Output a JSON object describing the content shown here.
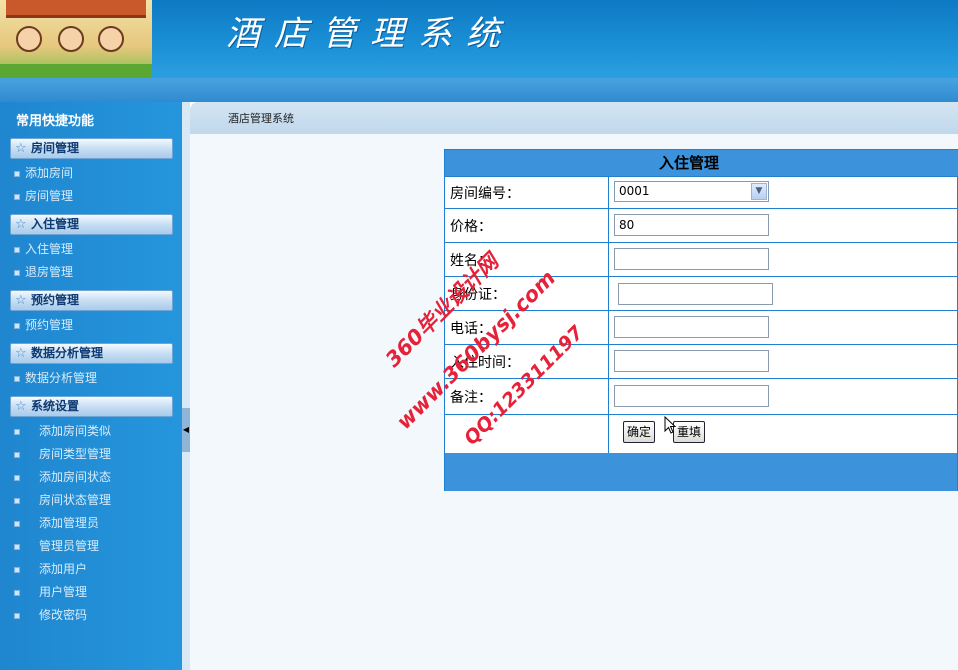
{
  "header": {
    "title": "酒店管理系统"
  },
  "sidebar": {
    "title": "常用快捷功能",
    "groups": [
      {
        "label": "房间管理",
        "items": [
          "添加房间",
          "房间管理"
        ]
      },
      {
        "label": "入住管理",
        "items": [
          "入住管理",
          "退房管理"
        ]
      },
      {
        "label": "预约管理",
        "items": [
          "预约管理"
        ]
      },
      {
        "label": "数据分析管理",
        "items": [
          "数据分析管理"
        ]
      },
      {
        "label": "系统设置",
        "items": [
          "添加房间类似",
          "房间类型管理",
          "添加房间状态",
          "房间状态管理",
          "添加管理员",
          "管理员管理",
          "添加用户",
          "用户管理",
          "修改密码"
        ]
      }
    ]
  },
  "breadcrumb": "酒店管理系统",
  "form": {
    "title": "入住管理",
    "fields": {
      "room_no": {
        "label": "房间编号：",
        "value": "0001"
      },
      "price": {
        "label": "价格：",
        "value": "80"
      },
      "name": {
        "label": "姓名：",
        "value": ""
      },
      "id_card": {
        "label": "身份证：",
        "value": ""
      },
      "phone": {
        "label": "电话：",
        "value": ""
      },
      "checkin_time": {
        "label": "入住时间：",
        "value": ""
      },
      "note": {
        "label": "备注：",
        "value": ""
      }
    },
    "submit_label": "确定",
    "reset_label": "重填"
  },
  "watermark": {
    "line1": "360毕业设计网",
    "line2": "www.360bysj.com",
    "line3": "QQ:123311197"
  },
  "colors": {
    "accent": "#3d92dc",
    "sidebar": "#2596dd",
    "watermark": "#e6223a"
  }
}
